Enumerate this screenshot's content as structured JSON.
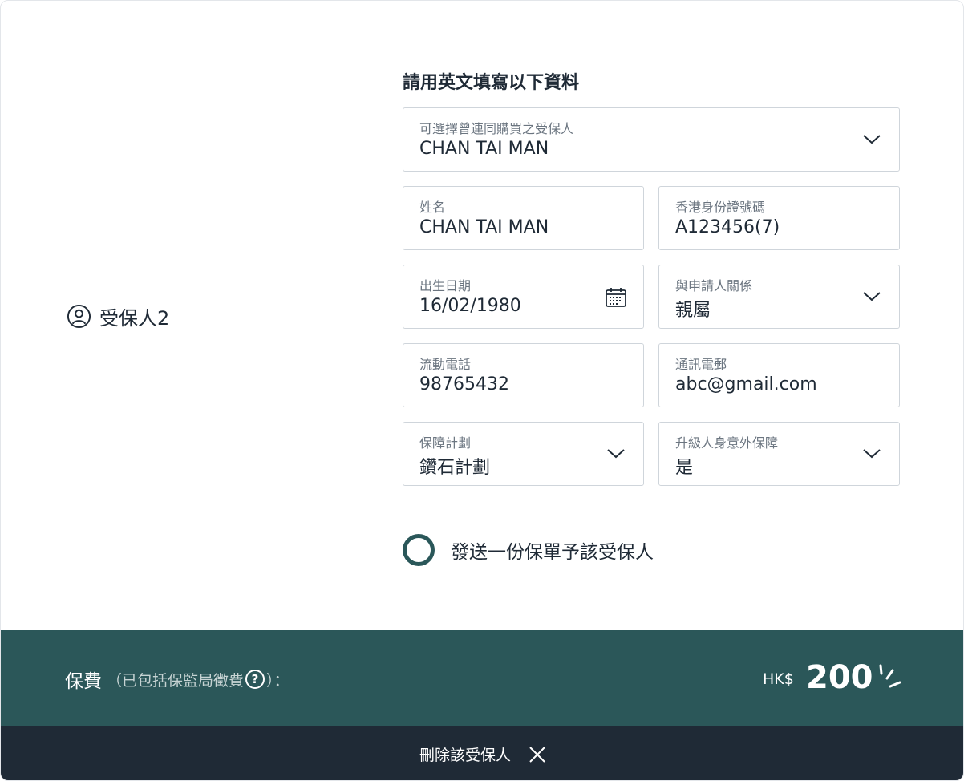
{
  "insured": {
    "label": "受保人2",
    "icon": "user-circle-icon"
  },
  "form": {
    "heading": "請用英文填寫以下資料",
    "previous_insured": {
      "label": "可選擇曾連同購買之受保人",
      "value": "CHAN TAI MAN"
    },
    "name": {
      "label": "姓名",
      "value": "CHAN TAI MAN"
    },
    "hkid": {
      "label": "香港身份證號碼",
      "value": "A123456(7)"
    },
    "dob": {
      "label": "出生日期",
      "value": "16/02/1980"
    },
    "relationship": {
      "label": "與申請人關係",
      "value": "親屬"
    },
    "mobile": {
      "label": "流動電話",
      "value": "98765432"
    },
    "email": {
      "label": "通訊電郵",
      "value": "abc@gmail.com"
    },
    "plan": {
      "label": "保障計劃",
      "value": "鑽石計劃"
    },
    "upgrade": {
      "label": "升級人身意外保障",
      "value": "是"
    },
    "send_policy_label": "發送一份保單予該受保人"
  },
  "premium": {
    "label": "保費",
    "note_prefix": "（已包括保監局徵費",
    "help_symbol": "?",
    "note_suffix": "）：",
    "currency": "HK$",
    "amount": "200"
  },
  "delete_label": "刪除該受保人",
  "colors": {
    "primary_teal": "#2b5759",
    "dark_navy": "#1f2a36",
    "border": "#cfd5db"
  }
}
